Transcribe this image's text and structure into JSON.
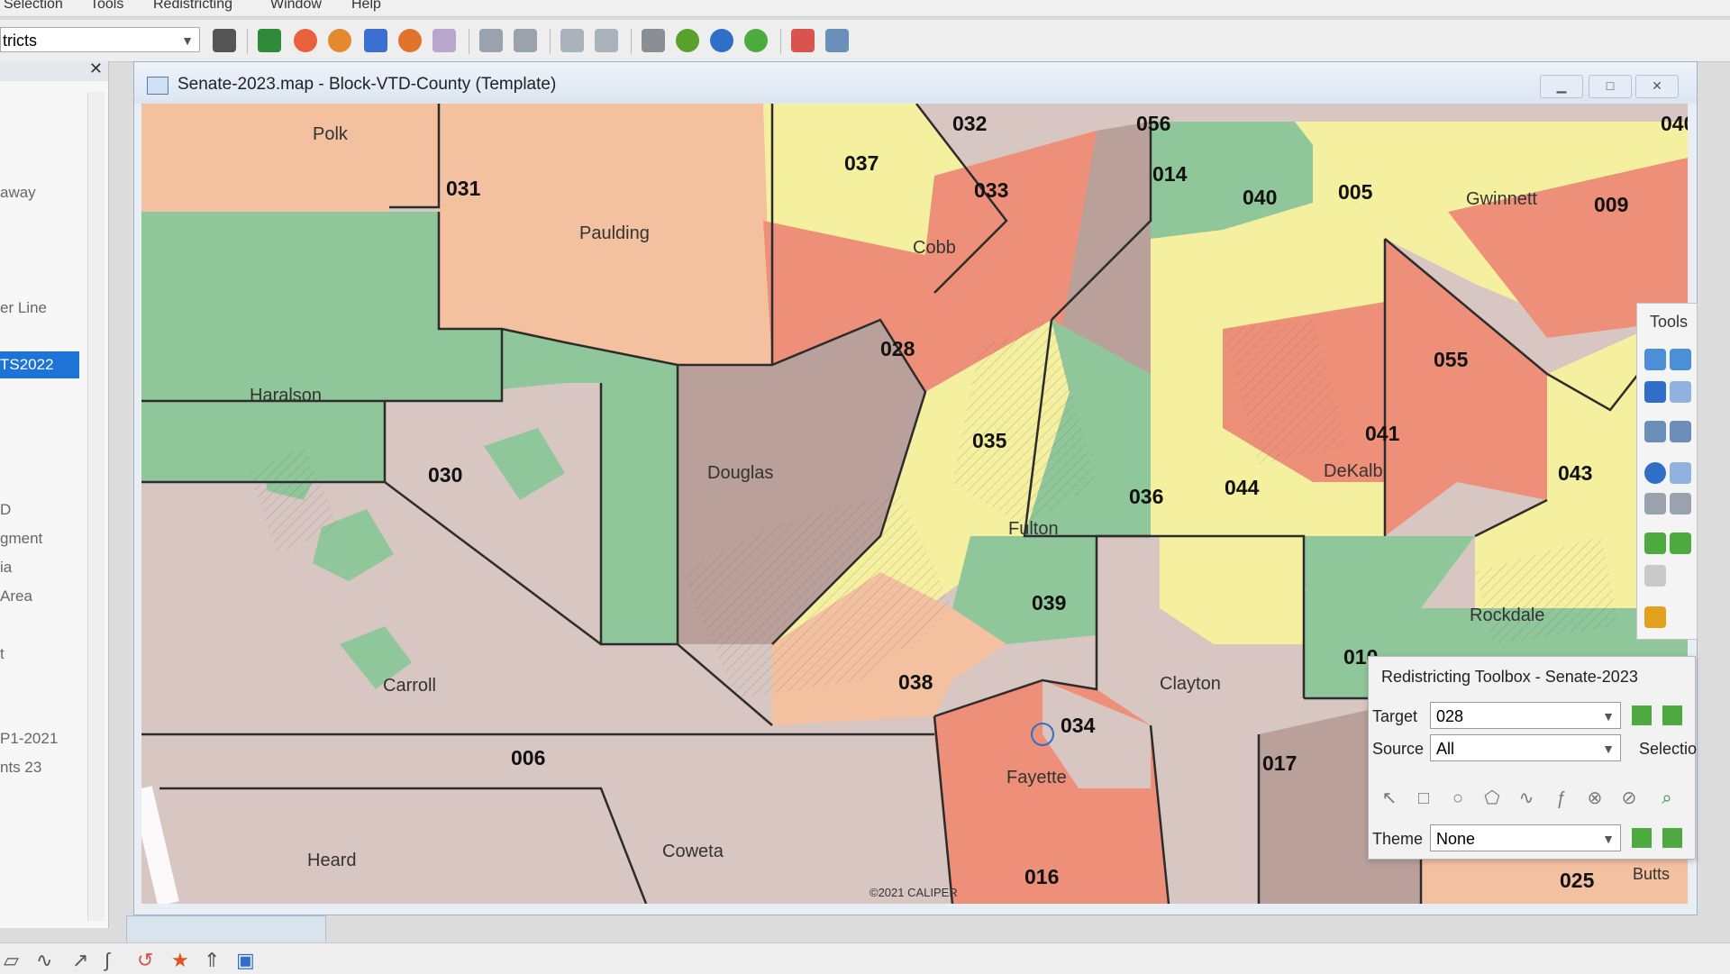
{
  "menubar": {
    "items": [
      "Selection",
      "Tools",
      "Redistricting",
      "Window",
      "Help"
    ]
  },
  "toolbar": {
    "layer_select": "tricts"
  },
  "left_panel": {
    "items": [
      "away",
      "er Line",
      "TS2022",
      "D",
      "gment",
      "ia",
      "Area",
      "t",
      "P1-2021",
      "nts 23"
    ],
    "selected_index": 2
  },
  "map_window": {
    "title": "Senate-2023.map - Block-VTD-County (Template)",
    "copyright": "©2021 CALIPER",
    "districts": [
      "032",
      "056",
      "040",
      "037",
      "033",
      "014",
      "005",
      "009",
      "031",
      "040",
      "028",
      "055",
      "035",
      "041",
      "043",
      "030",
      "036",
      "044",
      "039",
      "010",
      "038",
      "034",
      "006",
      "017",
      "016",
      "025"
    ],
    "counties": [
      "Polk",
      "Paulding",
      "Cobb",
      "Gwinnett",
      "Haralson",
      "Douglas",
      "DeKalb",
      "Fulton",
      "Rockdale",
      "Carroll",
      "Clayton",
      "Fayette",
      "Heard",
      "Coweta"
    ]
  },
  "tools_panel": {
    "title": "Tools"
  },
  "redistricting_toolbox": {
    "title": "Redistricting Toolbox - Senate-2023",
    "target_label": "Target",
    "target_value": "028",
    "source_label": "Source",
    "source_value": "All",
    "selection_label": "Selectio",
    "theme_label": "Theme",
    "theme_value": "None",
    "butts_label": "Butts"
  },
  "colors": {
    "green": "#8fc79a",
    "peach": "#f3c0a0",
    "salmon": "#ee9079",
    "yellow": "#f4f0a0",
    "mauve": "#b9a09a",
    "lightmauve": "#d8c6c2",
    "selected": "#1e73d6"
  }
}
